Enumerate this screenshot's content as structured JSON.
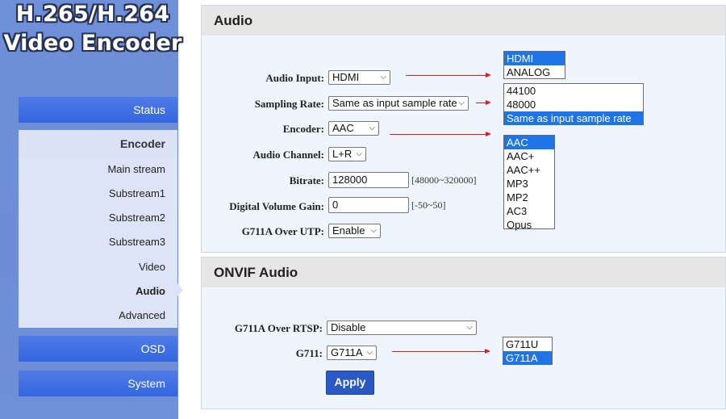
{
  "brand": {
    "line1": "H.265/H.264",
    "line2": "Video Encoder"
  },
  "sidebar": {
    "status": "Status",
    "encoder": "Encoder",
    "items": [
      {
        "label": "Main stream"
      },
      {
        "label": "Substream1"
      },
      {
        "label": "Substream2"
      },
      {
        "label": "Substream3"
      },
      {
        "label": "Video"
      },
      {
        "label": "Audio"
      },
      {
        "label": "Advanced"
      }
    ],
    "active_item": "Audio",
    "osd": "OSD",
    "system": "System"
  },
  "audio": {
    "title": "Audio",
    "input": {
      "label": "Audio Input:",
      "value": "HDMI",
      "options": [
        "HDMI",
        "ANALOG"
      ]
    },
    "sampling": {
      "label": "Sampling Rate:",
      "value": "Same as input sample rate",
      "options": [
        "44100",
        "48000",
        "Same as input sample rate"
      ]
    },
    "encoder": {
      "label": "Encoder:",
      "value": "AAC",
      "options": [
        "AAC",
        "AAC+",
        "AAC++",
        "MP3",
        "MP2",
        "AC3",
        "Opus"
      ]
    },
    "channel": {
      "label": "Audio Channel:",
      "value": "L+R"
    },
    "bitrate": {
      "label": "Bitrate:",
      "value": "128000",
      "hint": "[48000~320000]"
    },
    "gain": {
      "label": "Digital Volume Gain:",
      "value": "0",
      "hint": "[-50~50]"
    },
    "g711utp": {
      "label": "G711A Over UTP:",
      "value": "Enable"
    }
  },
  "onvif": {
    "title": "ONVIF Audio",
    "rtsp": {
      "label": "G711A Over RTSP:",
      "value": "Disable"
    },
    "g711": {
      "label": "G711:",
      "value": "G711A",
      "options": [
        "G711U",
        "G711A"
      ]
    },
    "apply": "Apply"
  },
  "colors": {
    "accent": "#3366e0",
    "selected": "#1f74e6",
    "arrow": "#d81e1e"
  }
}
